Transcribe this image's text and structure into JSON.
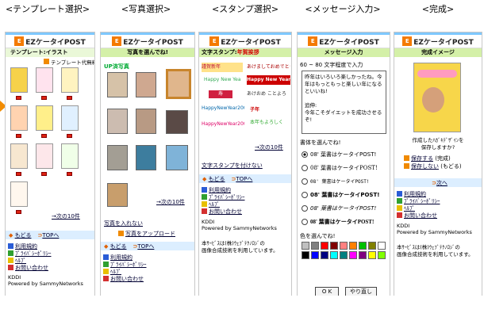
{
  "headers": [
    "<テンプレート選択>",
    "<写真選択>",
    "<スタンプ選択>",
    "<メッセージ入力>",
    "<完成>"
  ],
  "brand": {
    "mark": "E",
    "name": "EZケータイPOST",
    "accent": "#f47a00"
  },
  "template": {
    "title": "テンプレート:イラスト",
    "label_free": "テンプレート代無料",
    "next": "→次の10件"
  },
  "photo": {
    "prompt": "写真を選んでね!",
    "section": "UP済写真",
    "next": "→次の10件",
    "no_photo": "写真を入れない",
    "upload": "写真をアップロード"
  },
  "stamp": {
    "title_prefix": "文字スタンプ:",
    "title_sel": "年賀挨拶",
    "next": "→次の10件",
    "none": "文字スタンプを付けない",
    "stamps": [
      "謹賀新年",
      "あけましておめでとう",
      "Happy New Year 2008",
      "寿",
      "Happy New Year 2008",
      "あけおめ ことよろ",
      "HappyNewYear2008",
      "子年",
      "HappyNewYear2008",
      "本年もよろしく"
    ]
  },
  "message": {
    "title": "メッセージ入力",
    "guide": "60 ~ 80 文字程度で入力",
    "text": "昨年はいろいろ楽しかったね。今年はもっともっと楽しい年になるといいね!\n\n追伸:\n今年こそダイエットを成功させるぞ!",
    "font_label": "書体を選んでね!",
    "fonts": [
      "08' 葉書はケータイPOST!",
      "08' 葉書はケータイPOST!",
      "08' 葉書はケータイPOST!",
      "08' 葉書はケータイPOST!",
      "08' 葉書はケータイPOST!",
      "08' 葉書はケータイPOST!"
    ],
    "selected_font": 0,
    "color_label": "色を選んでね!",
    "colors": [
      "#c0c0c0",
      "#808080",
      "#ff0000",
      "#800000",
      "#ff8080",
      "#ff8000",
      "#00c000",
      "#808000",
      "#ffffff",
      "#000000",
      "#0000ff",
      "#000080",
      "#00ffff",
      "#008080",
      "#ff00ff",
      "#800080",
      "#ffff00",
      "#80ff00"
    ],
    "ok": "O K",
    "redo": "やり直し"
  },
  "complete": {
    "title": "完成イメージ",
    "question": "作成したﾊｶﾞｷﾃﾞｻﾞｲﾝを\n保存しますか?",
    "save": "保存する",
    "save_note": "(完成)",
    "nosave": "保存しない",
    "nosave_note": "(もどる)",
    "next": "次へ"
  },
  "footer": {
    "back": "もどる",
    "top": "TOPへ",
    "links": [
      "利用規約",
      "ﾌﾟﾗｲﾊﾞｼｰﾎﾟﾘｼｰ",
      "ﾍﾙﾌﾟ",
      "お問い合わせ"
    ],
    "kddi": "KDDI",
    "powered": "Powered by SammyNetworks",
    "note": "本ｻｰﾋﾞｽは(株)ｳｪﾌﾞﾃｸﾉﾛｼﾞの\n画像合成技術を利用しています。"
  }
}
